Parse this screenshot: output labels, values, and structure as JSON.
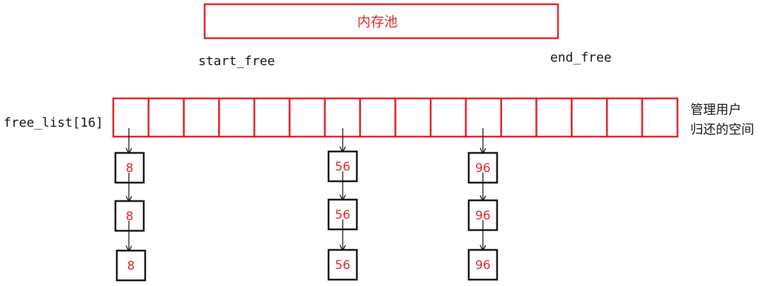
{
  "memory_pool": {
    "label": "内存池"
  },
  "pointers": {
    "start_free": "start_free",
    "end_free": "end_free"
  },
  "free_list": {
    "label": "free_list[16]",
    "slot_count": 16,
    "note_line1": "管理用户",
    "note_line2": "归还的空间"
  },
  "chains": [
    {
      "slot": 0,
      "nodes": [
        "8",
        "8",
        "8"
      ]
    },
    {
      "slot": 6,
      "nodes": [
        "56",
        "56",
        "56"
      ]
    },
    {
      "slot": 10,
      "nodes": [
        "96",
        "96",
        "96"
      ]
    }
  ],
  "colors": {
    "accent": "#e0202a",
    "line": "#111111",
    "background": "#ffffff"
  }
}
